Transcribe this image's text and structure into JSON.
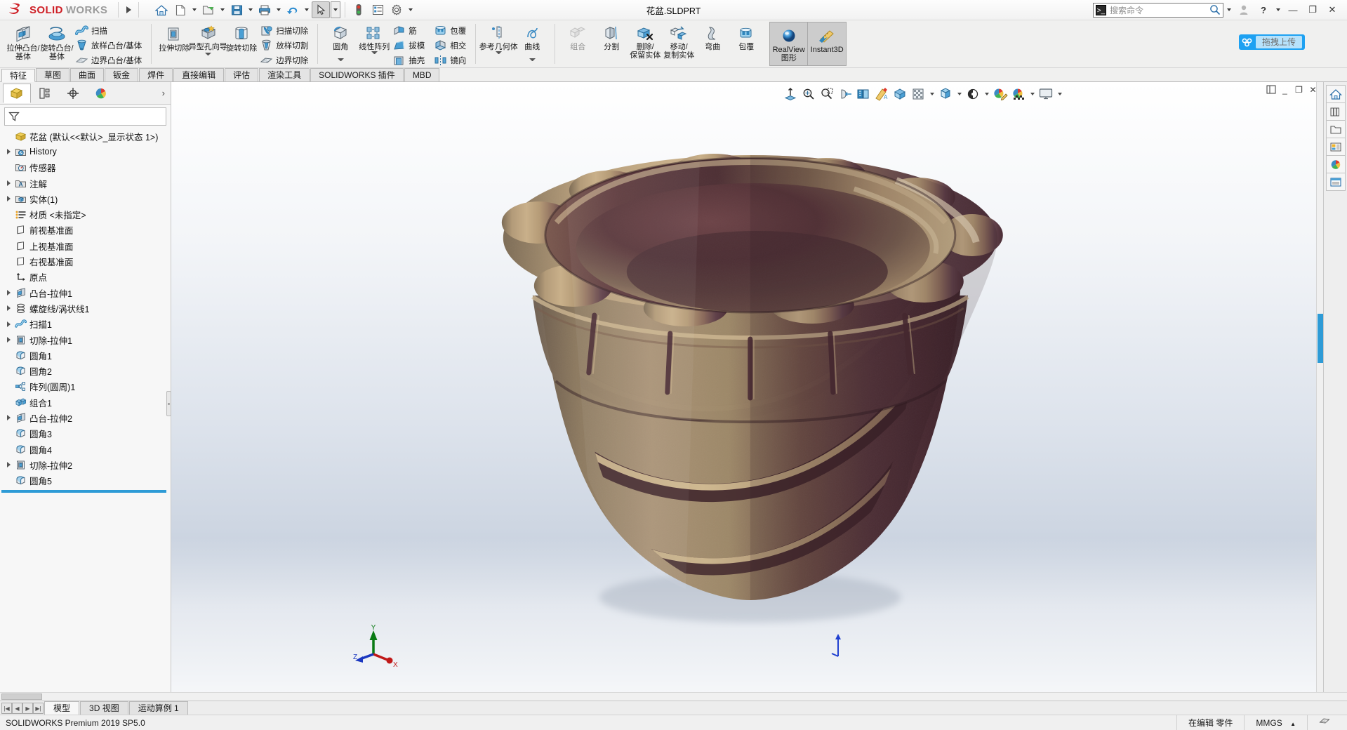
{
  "app": {
    "brand_ds": "2S",
    "brand_solid": "SOLID",
    "brand_works": "WORKS",
    "document_title": "花盆.SLDPRT",
    "accent_blue": "#2e9bd6",
    "brand_red": "#cf2027"
  },
  "quick_access": {
    "items": [
      {
        "name": "home-icon",
        "label": "主页"
      },
      {
        "name": "new-document-icon",
        "label": "新建"
      },
      {
        "name": "open-folder-icon",
        "label": "打开"
      },
      {
        "name": "save-icon",
        "label": "保存"
      },
      {
        "name": "print-icon",
        "label": "打印"
      },
      {
        "name": "undo-icon",
        "label": "撤销"
      },
      {
        "name": "select-arrow-icon",
        "label": "选择"
      },
      {
        "name": "rebuild-icon",
        "label": "重建模型"
      },
      {
        "name": "options-list-icon",
        "label": "文件属性"
      },
      {
        "name": "gear-icon",
        "label": "选项"
      }
    ]
  },
  "search": {
    "placeholder": "搜索命令"
  },
  "window_controls": {
    "user": "用户",
    "help": "?",
    "minimize": "—",
    "restore": "❐",
    "close": "✕"
  },
  "upload_widget": {
    "label": "拖拽上传"
  },
  "ribbon": {
    "groups": [
      {
        "name": "boss-group",
        "big": [
          {
            "label": "拉伸凸台/基体",
            "icon": "extrude-boss-icon",
            "dropdown": false
          },
          {
            "label": "旋转凸台/基体",
            "icon": "revolve-boss-icon",
            "dropdown": false
          }
        ],
        "small": [
          {
            "label": "扫描",
            "icon": "sweep-icon"
          },
          {
            "label": "放样凸台/基体",
            "icon": "loft-boss-icon"
          },
          {
            "label": "边界凸台/基体",
            "icon": "boundary-boss-icon"
          }
        ]
      },
      {
        "name": "cut-group",
        "big": [
          {
            "label": "拉伸切除",
            "icon": "extrude-cut-icon",
            "dropdown": false
          },
          {
            "label": "异型孔向导",
            "icon": "hole-wizard-icon",
            "dropdown": true
          },
          {
            "label": "旋转切除",
            "icon": "revolve-cut-icon",
            "dropdown": false
          }
        ],
        "small": [
          {
            "label": "扫描切除",
            "icon": "sweep-cut-icon"
          },
          {
            "label": "放样切割",
            "icon": "loft-cut-icon"
          },
          {
            "label": "边界切除",
            "icon": "boundary-cut-icon"
          }
        ]
      },
      {
        "name": "feature-group",
        "big": [
          {
            "label": "圆角",
            "icon": "fillet-icon",
            "dropdown": true
          },
          {
            "label": "线性阵列",
            "icon": "linear-pattern-icon",
            "dropdown": true
          }
        ],
        "small": [
          {
            "label": "筋",
            "icon": "rib-icon"
          },
          {
            "label": "拔模",
            "icon": "draft-icon"
          },
          {
            "label": "抽壳",
            "icon": "shell-icon"
          }
        ],
        "small2": [
          {
            "label": "包覆",
            "icon": "wrap-icon"
          },
          {
            "label": "相交",
            "icon": "intersect-icon"
          },
          {
            "label": "镜向",
            "icon": "mirror-icon"
          }
        ]
      },
      {
        "name": "reference-group",
        "big": [
          {
            "label": "参考几何体",
            "icon": "reference-geometry-icon",
            "dropdown": true
          },
          {
            "label": "曲线",
            "icon": "curves-icon",
            "dropdown": true
          }
        ]
      },
      {
        "name": "bodies-group",
        "big": [
          {
            "label": "组合",
            "icon": "combine-icon",
            "disabled": true
          },
          {
            "label": "分割",
            "icon": "split-icon"
          },
          {
            "label": "删除/保留实体",
            "icon": "delete-keep-body-icon"
          },
          {
            "label": "移动/复制实体",
            "icon": "move-copy-body-icon"
          },
          {
            "label": "弯曲",
            "icon": "flex-icon"
          },
          {
            "label": "包覆",
            "icon": "wrap-body-icon"
          }
        ]
      }
    ],
    "toggle_group": [
      {
        "label": "RealView 图形",
        "icon": "realview-sphere-icon",
        "active": true
      },
      {
        "label": "Instant3D",
        "icon": "instant3d-icon",
        "active": true
      }
    ]
  },
  "command_tabs": [
    {
      "label": "特征",
      "active": true
    },
    {
      "label": "草图",
      "active": false
    },
    {
      "label": "曲面",
      "active": false
    },
    {
      "label": "钣金",
      "active": false
    },
    {
      "label": "焊件",
      "active": false
    },
    {
      "label": "直接编辑",
      "active": false
    },
    {
      "label": "评估",
      "active": false
    },
    {
      "label": "渲染工具",
      "active": false
    },
    {
      "label": "SOLIDWORKS 插件",
      "active": false
    },
    {
      "label": "MBD",
      "active": false
    }
  ],
  "view_toolbar": {
    "buttons": [
      {
        "name": "zoom-to-fit-icon",
        "label": "整屏显示全图",
        "caret": false
      },
      {
        "name": "zoom-to-area-icon",
        "label": "局部放大",
        "caret": false
      },
      {
        "name": "previous-view-icon",
        "label": "上一视图",
        "caret": false
      },
      {
        "name": "section-view-icon",
        "label": "剖面视图",
        "caret": false
      },
      {
        "name": "view-orientation-icon",
        "label": "视图定向",
        "caret": false
      },
      {
        "name": "display-style-icon",
        "label": "显示样式",
        "caret": true
      },
      {
        "name": "hide-show-items-icon",
        "label": "隐藏/显示项目",
        "caret": true
      },
      {
        "name": "edit-appearance-icon",
        "label": "编辑外观",
        "caret": false
      },
      {
        "name": "apply-scene-icon",
        "label": "应用布景",
        "caret": true
      },
      {
        "name": "view-settings-icon",
        "label": "视图设定",
        "caret": true
      }
    ]
  },
  "feature_manager": {
    "tabs": [
      {
        "name": "feature-tree-tab",
        "label": "FeatureManager 设计树",
        "active": true
      },
      {
        "name": "property-manager-tab",
        "label": "PropertyManager",
        "active": false
      },
      {
        "name": "configuration-manager-tab",
        "label": "ConfigurationManager",
        "active": false
      },
      {
        "name": "display-manager-tab",
        "label": "DisplayManager",
        "active": false
      }
    ],
    "filter_placeholder": "",
    "tree": [
      {
        "label": "花盆  (默认<<默认>_显示状态 1>)",
        "icon": "part-icon",
        "arrow": false,
        "indent": 0,
        "root": true
      },
      {
        "label": "History",
        "icon": "history-icon",
        "arrow": true,
        "indent": 1
      },
      {
        "label": "传感器",
        "icon": "sensors-icon",
        "arrow": false,
        "indent": 1
      },
      {
        "label": "注解",
        "icon": "annotations-icon",
        "arrow": true,
        "indent": 1
      },
      {
        "label": "实体(1)",
        "icon": "solid-bodies-icon",
        "arrow": true,
        "indent": 1
      },
      {
        "label": "材质 <未指定>",
        "icon": "material-icon",
        "arrow": false,
        "indent": 1
      },
      {
        "label": "前视基准面",
        "icon": "plane-icon",
        "arrow": false,
        "indent": 1
      },
      {
        "label": "上视基准面",
        "icon": "plane-icon",
        "arrow": false,
        "indent": 1
      },
      {
        "label": "右视基准面",
        "icon": "plane-icon",
        "arrow": false,
        "indent": 1
      },
      {
        "label": "原点",
        "icon": "origin-icon",
        "arrow": false,
        "indent": 1
      },
      {
        "label": "凸台-拉伸1",
        "icon": "extrude-boss-tree-icon",
        "arrow": true,
        "indent": 1
      },
      {
        "label": "螺旋线/涡状线1",
        "icon": "helix-icon",
        "arrow": true,
        "indent": 1
      },
      {
        "label": "扫描1",
        "icon": "sweep-tree-icon",
        "arrow": true,
        "indent": 1
      },
      {
        "label": "切除-拉伸1",
        "icon": "extrude-cut-tree-icon",
        "arrow": true,
        "indent": 1
      },
      {
        "label": "圆角1",
        "icon": "fillet-tree-icon",
        "arrow": false,
        "indent": 1
      },
      {
        "label": "圆角2",
        "icon": "fillet-tree-icon",
        "arrow": false,
        "indent": 1
      },
      {
        "label": "阵列(圆周)1",
        "icon": "circular-pattern-tree-icon",
        "arrow": false,
        "indent": 1
      },
      {
        "label": "组合1",
        "icon": "combine-tree-icon",
        "arrow": false,
        "indent": 1
      },
      {
        "label": "凸台-拉伸2",
        "icon": "extrude-boss-tree-icon",
        "arrow": true,
        "indent": 1
      },
      {
        "label": "圆角3",
        "icon": "fillet-tree-icon",
        "arrow": false,
        "indent": 1
      },
      {
        "label": "圆角4",
        "icon": "fillet-tree-icon",
        "arrow": false,
        "indent": 1
      },
      {
        "label": "切除-拉伸2",
        "icon": "extrude-cut-tree-icon",
        "arrow": true,
        "indent": 1
      },
      {
        "label": "圆角5",
        "icon": "fillet-tree-icon",
        "arrow": false,
        "indent": 1
      }
    ]
  },
  "graphics": {
    "model_name": "花盆",
    "triad": {
      "x": "X",
      "y": "Y",
      "z": "Z"
    },
    "colors": {
      "bronze_light": "#c3a883",
      "bronze_mid": "#8e7a5f",
      "bronze_dark": "#5b4436",
      "plum_dark": "#4e2f34",
      "plum_mid": "#6d4a4c",
      "rim_highlight": "#d8c19b",
      "background_top": "#ffffff",
      "background_bottom": "#bcc6d6"
    }
  },
  "task_pane": {
    "buttons": [
      {
        "name": "sw-resources-icon",
        "label": "SOLIDWORKS 资源"
      },
      {
        "name": "design-library-icon",
        "label": "设计库"
      },
      {
        "name": "file-explorer-icon",
        "label": "文件探索器"
      },
      {
        "name": "view-palette-icon",
        "label": "视图调色板"
      },
      {
        "name": "appearances-scenes-icon",
        "label": "外观、布景和贴图"
      },
      {
        "name": "custom-properties-icon",
        "label": "自定义属性"
      }
    ]
  },
  "document_tabs": [
    {
      "label": "模型",
      "active": true
    },
    {
      "label": "3D 视图",
      "active": false
    },
    {
      "label": "运动算例 1",
      "active": false
    }
  ],
  "status_bar": {
    "product": "SOLIDWORKS Premium 2019 SP5.0",
    "edit_state": "在编辑 零件",
    "units": "MMGS",
    "units_caret": "▲"
  }
}
